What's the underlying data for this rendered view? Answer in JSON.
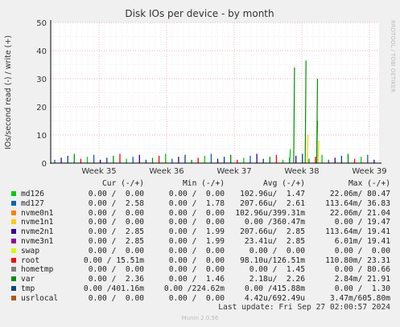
{
  "chart_data": {
    "type": "line",
    "title": "Disk IOs per device - by month",
    "ylabel": "IOs/second read (-) / write (+)",
    "ylim": [
      0,
      50
    ],
    "yticks": [
      0,
      10,
      20,
      30,
      40,
      50
    ],
    "xticks": [
      "Week 35",
      "Week 36",
      "Week 37",
      "Week 38",
      "Week 39"
    ],
    "grid": true,
    "watermark": "RRDTOOL / TOBI OETIKER",
    "series": [
      {
        "name": "md126",
        "color": "#00cc00"
      },
      {
        "name": "md127",
        "color": "#0066b3"
      },
      {
        "name": "nvme0n1",
        "color": "#ff8000"
      },
      {
        "name": "nvme1n1",
        "color": "#ffcc00"
      },
      {
        "name": "nvme2n1",
        "color": "#330099"
      },
      {
        "name": "nvme3n1",
        "color": "#990099"
      },
      {
        "name": "swap",
        "color": "#ccff00"
      },
      {
        "name": "root",
        "color": "#ff0000"
      },
      {
        "name": "hometmp",
        "color": "#808080"
      },
      {
        "name": "var",
        "color": "#008f00"
      },
      {
        "name": "tmp",
        "color": "#00487d"
      },
      {
        "name": "usrlocal",
        "color": "#b35a00"
      }
    ],
    "spikes": [
      {
        "series": "var",
        "x_week": 37.88,
        "value": 34
      },
      {
        "series": "var",
        "x_week": 38.05,
        "value": 36.5
      },
      {
        "series": "var",
        "x_week": 38.22,
        "value": 30
      },
      {
        "series": "var",
        "x_week": 38.22,
        "value": 15
      },
      {
        "series": "nvme1n1",
        "x_week": 38.08,
        "value": 10
      },
      {
        "series": "nvme1n1",
        "x_week": 38.24,
        "value": 8
      },
      {
        "series": "md126",
        "x_week": 37.82,
        "value": 5
      }
    ]
  },
  "legend": {
    "headers": {
      "cur": "Cur (-/+)",
      "min": "Min (-/+)",
      "avg": "Avg (-/+)",
      "max": "Max (-/+)"
    },
    "rows": [
      {
        "name": "md126",
        "cur": "0.00 /  0.00",
        "min": "0.00 /  0.00",
        "avg": "102.96u/  1.47",
        "max": "22.06m/ 80.47"
      },
      {
        "name": "md127",
        "cur": "0.00 /  2.58",
        "min": "0.00 /  1.78",
        "avg": "207.66u/  2.61",
        "max": "113.64m/ 36.83"
      },
      {
        "name": "nvme0n1",
        "cur": "0.00 /  0.00",
        "min": "0.00 /  0.00",
        "avg": "102.96u/399.31m",
        "max": "22.06m/ 21.04"
      },
      {
        "name": "nvme1n1",
        "cur": "0.00 /  0.00",
        "min": "0.00 /  0.00",
        "avg": "0.00 /360.47m",
        "max": "0.00 / 19.47"
      },
      {
        "name": "nvme2n1",
        "cur": "0.00 /  2.85",
        "min": "0.00 /  1.99",
        "avg": "207.66u/  2.85",
        "max": "113.64m/ 19.41"
      },
      {
        "name": "nvme3n1",
        "cur": "0.00 /  2.85",
        "min": "0.00 /  1.99",
        "avg": "23.41u/  2.85",
        "max": "6.01m/ 19.41"
      },
      {
        "name": "swap",
        "cur": "0.00 /  0.00",
        "min": "0.00 /  0.00",
        "avg": "0.00 /  0.00",
        "max": "0.00 /  0.00"
      },
      {
        "name": "root",
        "cur": "0.00 / 15.51m",
        "min": "0.00 /  0.00",
        "avg": "98.10u/126.51m",
        "max": "110.80m/ 23.31"
      },
      {
        "name": "hometmp",
        "cur": "0.00 /  0.00",
        "min": "0.00 /  0.00",
        "avg": "0.00 /  1.45",
        "max": "0.00 / 80.66"
      },
      {
        "name": "var",
        "cur": "0.00 /  2.36",
        "min": "0.00 /  1.46",
        "avg": "2.18u/  2.26",
        "max": "2.84m/ 21.91"
      },
      {
        "name": "tmp",
        "cur": "0.00 /401.16m",
        "min": "0.00 /224.62m",
        "avg": "0.00 /415.88m",
        "max": "0.00 /  1.30"
      },
      {
        "name": "usrlocal",
        "cur": "0.00 /  0.00",
        "min": "0.00 /  0.00",
        "avg": "4.42u/692.49u",
        "max": "3.47m/605.80m"
      }
    ]
  },
  "last_update": "Last update: Fri Sep 27 02:00:57 2024",
  "version": "Munin 2.0.56"
}
